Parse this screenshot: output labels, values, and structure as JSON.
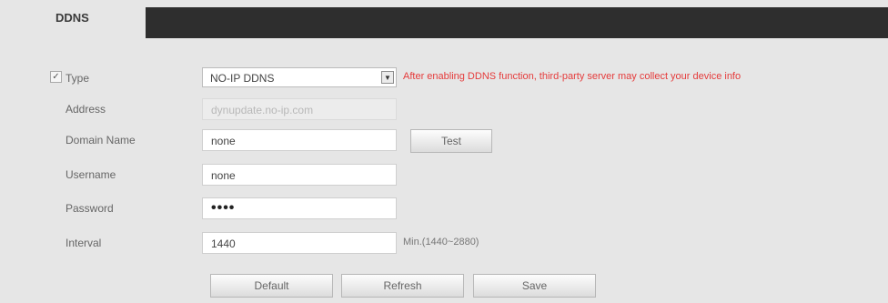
{
  "tab": {
    "label": "DDNS"
  },
  "form": {
    "type": {
      "checked": true,
      "check_mark": "✓",
      "label": "Type",
      "selected": "NO-IP DDNS",
      "dropdown_icon": "chevron-down-icon",
      "warning": "After enabling DDNS function, third-party server may collect your device info"
    },
    "address": {
      "label": "Address",
      "value": "dynupdate.no-ip.com"
    },
    "domain_name": {
      "label": "Domain Name",
      "value": "none",
      "test_label": "Test"
    },
    "username": {
      "label": "Username",
      "value": "none"
    },
    "password": {
      "label": "Password",
      "value": "••••"
    },
    "interval": {
      "label": "Interval",
      "value": "1440",
      "unit": "Min.(1440~2880)"
    }
  },
  "buttons": {
    "default": "Default",
    "refresh": "Refresh",
    "save": "Save"
  },
  "colors": {
    "warning": "#e53b3b",
    "tab_bar": "#2e2e2e",
    "background": "#e6e6e6"
  }
}
